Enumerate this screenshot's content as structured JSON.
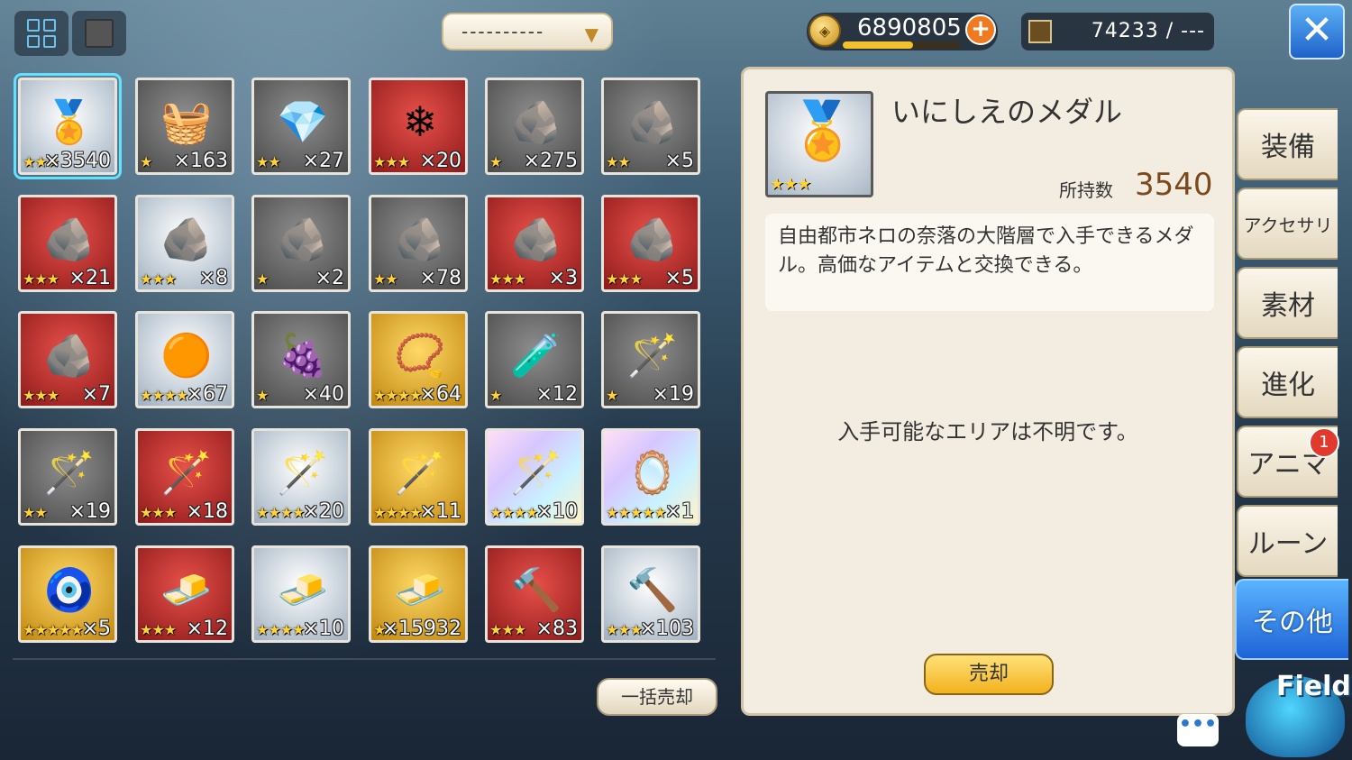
{
  "header": {
    "filter_label": "----------",
    "gold": "6890805",
    "gold_bar_fraction": 0.6,
    "capacity": "74233 / ---"
  },
  "items": [
    {
      "art": "🏅",
      "bg": "silver",
      "stars": "★★★",
      "count": "×3540",
      "selected": true
    },
    {
      "art": "🧺",
      "bg": "gray",
      "stars": "★",
      "count": "×163"
    },
    {
      "art": "💎",
      "bg": "gray",
      "stars": "★★",
      "count": "×27"
    },
    {
      "art": "❄",
      "bg": "red",
      "stars": "★★★",
      "count": "×20"
    },
    {
      "art": "🪨",
      "bg": "gray",
      "stars": "★",
      "count": "×275"
    },
    {
      "art": "🪨",
      "bg": "gray",
      "stars": "★★",
      "count": "×5"
    },
    {
      "art": "🪨",
      "bg": "red",
      "stars": "★★★",
      "count": "×21"
    },
    {
      "art": "🪨",
      "bg": "silver",
      "stars": "★★★",
      "count": "×8"
    },
    {
      "art": "🪨",
      "bg": "gray",
      "stars": "★",
      "count": "×2"
    },
    {
      "art": "🪨",
      "bg": "gray",
      "stars": "★★",
      "count": "×78"
    },
    {
      "art": "🪨",
      "bg": "red",
      "stars": "★★★",
      "count": "×3"
    },
    {
      "art": "🪨",
      "bg": "red",
      "stars": "★★★",
      "count": "×5"
    },
    {
      "art": "🪨",
      "bg": "red",
      "stars": "★★★",
      "count": "×7"
    },
    {
      "art": "🟠",
      "bg": "silver",
      "stars": "★★★★",
      "count": "×67"
    },
    {
      "art": "🍇",
      "bg": "gray",
      "stars": "★",
      "count": "×40"
    },
    {
      "art": "📿",
      "bg": "gold",
      "stars": "★★★★",
      "count": "×64"
    },
    {
      "art": "🧪",
      "bg": "gray",
      "stars": "★",
      "count": "×12"
    },
    {
      "art": "🪄",
      "bg": "gray",
      "stars": "★",
      "count": "×19"
    },
    {
      "art": "🪄",
      "bg": "gray",
      "stars": "★★",
      "count": "×19"
    },
    {
      "art": "🪄",
      "bg": "red",
      "stars": "★★★",
      "count": "×18"
    },
    {
      "art": "🪄",
      "bg": "silver",
      "stars": "★★★★",
      "count": "×20"
    },
    {
      "art": "🪄",
      "bg": "gold",
      "stars": "★★★★",
      "count": "×11"
    },
    {
      "art": "🪄",
      "bg": "rainbow",
      "stars": "★★★★",
      "count": "×10"
    },
    {
      "art": "🪞",
      "bg": "rainbow",
      "stars": "★★★★★",
      "count": "×1"
    },
    {
      "art": "🧿",
      "bg": "gold",
      "stars": "★★★★★",
      "count": "×5"
    },
    {
      "art": "🧈",
      "bg": "red",
      "stars": "★★★",
      "count": "×12"
    },
    {
      "art": "🧈",
      "bg": "silver",
      "stars": "★★★★",
      "count": "×10"
    },
    {
      "art": "🧈",
      "bg": "gold",
      "stars": "★★",
      "count": "×15932"
    },
    {
      "art": "🔨",
      "bg": "red",
      "stars": "★★★",
      "count": "×83"
    },
    {
      "art": "🔨",
      "bg": "silver",
      "stars": "★★★",
      "count": "×103"
    }
  ],
  "bulk_sell_label": "一括売却",
  "detail": {
    "name": "いにしえのメダル",
    "thumb_art": "🏅",
    "thumb_stars": "★★★",
    "owned_label": "所持数",
    "owned_value": "3540",
    "description": "自由都市ネロの奈落の大階層で入手できるメダル。高価なアイテムと交換できる。",
    "area_text": "入手可能なエリアは不明です。",
    "sell_label": "売却"
  },
  "tabs": [
    {
      "label": "装備"
    },
    {
      "label": "アクセサリ"
    },
    {
      "label": "素材"
    },
    {
      "label": "進化"
    },
    {
      "label": "アニマ"
    },
    {
      "label": "ルーン"
    },
    {
      "label": "その他",
      "active": true
    }
  ],
  "badge_count": "1",
  "field_label": "Field",
  "chat_label": "•••",
  "icons": {
    "grid_view": "grid-view-icon",
    "list_view": "list-view-icon",
    "coin": "coin-icon",
    "plus": "plus-icon",
    "inventory": "inventory-icon",
    "close": "close-icon",
    "dropdown": "chevron-down-icon"
  }
}
